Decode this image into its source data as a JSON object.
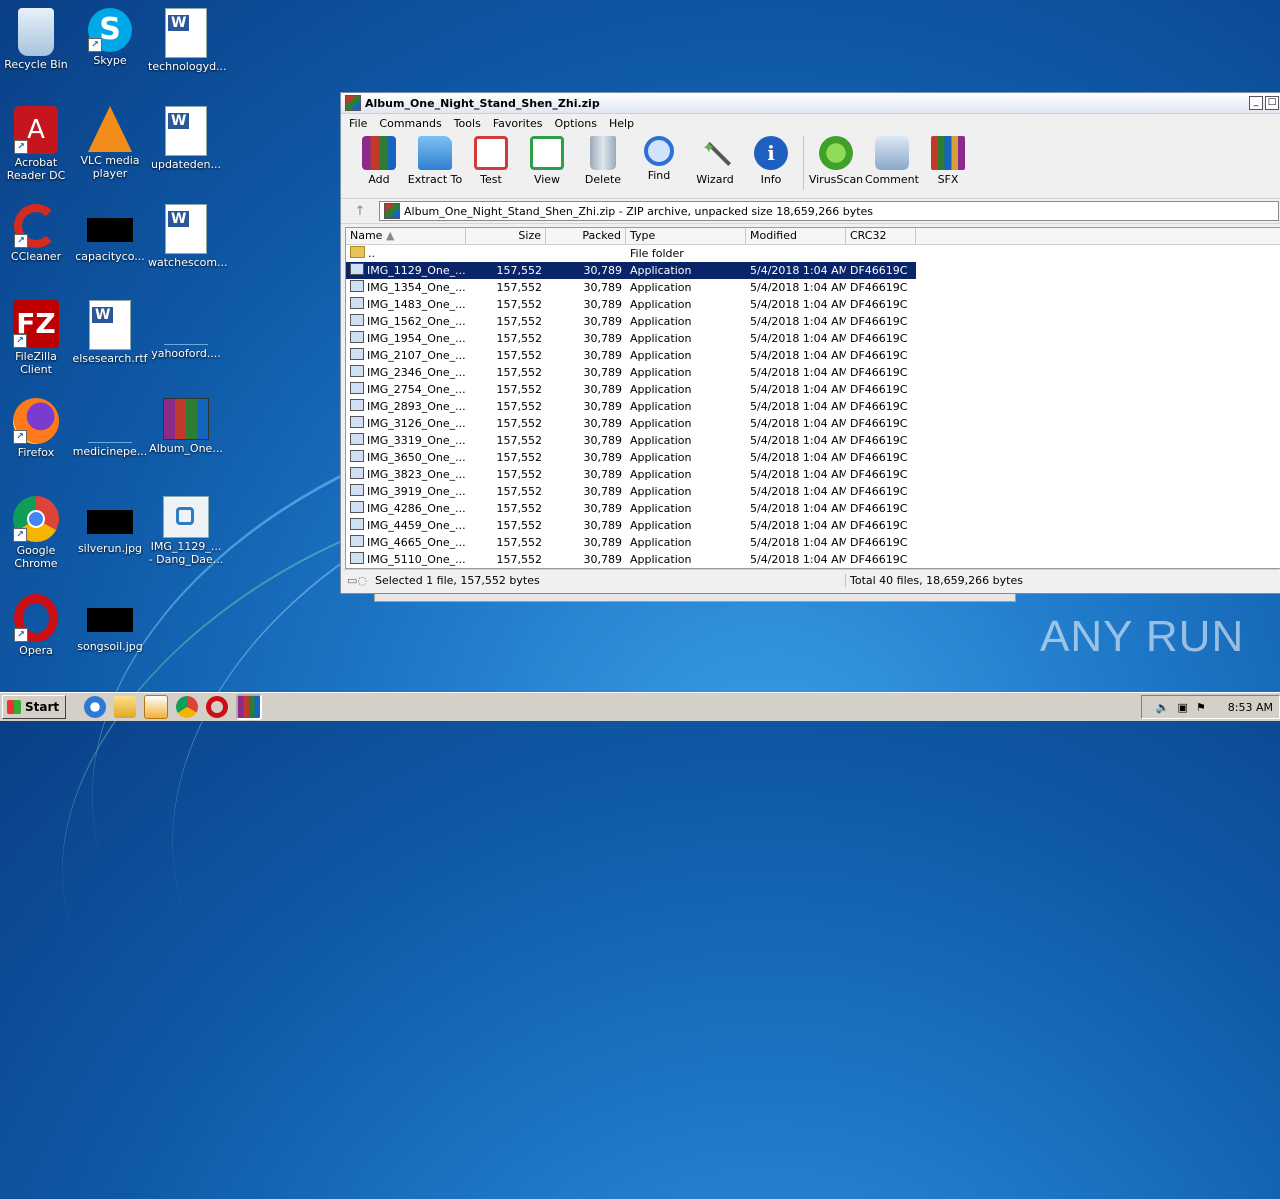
{
  "desktop": {
    "icons": [
      {
        "label": "Recycle Bin"
      },
      {
        "label": "Skype"
      },
      {
        "label": "technologyd..."
      },
      {
        "label": "Acrobat Reader DC"
      },
      {
        "label": "VLC media player"
      },
      {
        "label": "updateden..."
      },
      {
        "label": "CCleaner"
      },
      {
        "label": "capacityco..."
      },
      {
        "label": "watchescom..."
      },
      {
        "label": "FileZilla Client"
      },
      {
        "label": "elsesearch.rtf"
      },
      {
        "label": "yahooford...."
      },
      {
        "label": "Firefox"
      },
      {
        "label": "medicinepe..."
      },
      {
        "label": "Album_One..."
      },
      {
        "label": "Google Chrome"
      },
      {
        "label": "silverun.jpg"
      },
      {
        "label": "IMG_1129_... - Dang_Dae..."
      },
      {
        "label": "Opera"
      },
      {
        "label": "songsoil.jpg"
      }
    ]
  },
  "window": {
    "title": "Album_One_Night_Stand_Shen_Zhi.zip",
    "menu": [
      "File",
      "Commands",
      "Tools",
      "Favorites",
      "Options",
      "Help"
    ],
    "toolbar": [
      {
        "label": "Add",
        "color": "#c0392b"
      },
      {
        "label": "Extract To",
        "color": "#3b8fd8"
      },
      {
        "label": "Test",
        "color": "#d23b3b"
      },
      {
        "label": "View",
        "color": "#2e9e4a"
      },
      {
        "label": "Delete",
        "color": "#8a9bb0"
      },
      {
        "label": "Find",
        "color": "#2f6fd6"
      },
      {
        "label": "Wizard",
        "color": "#6aa9d8"
      },
      {
        "label": "Info",
        "color": "#1e5fc0"
      },
      {
        "label": "VirusScan",
        "color": "#3fa12a"
      },
      {
        "label": "Comment",
        "color": "#8aa8c8"
      },
      {
        "label": "SFX",
        "color": "#d9a03a"
      }
    ],
    "address": "Album_One_Night_Stand_Shen_Zhi.zip - ZIP archive, unpacked size 18,659,266 bytes",
    "columns": {
      "name": "Name",
      "size": "Size",
      "packed": "Packed",
      "type": "Type",
      "modified": "Modified",
      "crc": "CRC32"
    },
    "parent_row": {
      "name": "..",
      "type": "File folder"
    },
    "files": [
      {
        "name": "IMG_1129_One_...",
        "size": "157,552",
        "packed": "30,789",
        "type": "Application",
        "modified": "5/4/2018 1:04 AM",
        "crc": "DF46619C"
      },
      {
        "name": "IMG_1354_One_...",
        "size": "157,552",
        "packed": "30,789",
        "type": "Application",
        "modified": "5/4/2018 1:04 AM",
        "crc": "DF46619C"
      },
      {
        "name": "IMG_1483_One_...",
        "size": "157,552",
        "packed": "30,789",
        "type": "Application",
        "modified": "5/4/2018 1:04 AM",
        "crc": "DF46619C"
      },
      {
        "name": "IMG_1562_One_...",
        "size": "157,552",
        "packed": "30,789",
        "type": "Application",
        "modified": "5/4/2018 1:04 AM",
        "crc": "DF46619C"
      },
      {
        "name": "IMG_1954_One_...",
        "size": "157,552",
        "packed": "30,789",
        "type": "Application",
        "modified": "5/4/2018 1:04 AM",
        "crc": "DF46619C"
      },
      {
        "name": "IMG_2107_One_...",
        "size": "157,552",
        "packed": "30,789",
        "type": "Application",
        "modified": "5/4/2018 1:04 AM",
        "crc": "DF46619C"
      },
      {
        "name": "IMG_2346_One_...",
        "size": "157,552",
        "packed": "30,789",
        "type": "Application",
        "modified": "5/4/2018 1:04 AM",
        "crc": "DF46619C"
      },
      {
        "name": "IMG_2754_One_...",
        "size": "157,552",
        "packed": "30,789",
        "type": "Application",
        "modified": "5/4/2018 1:04 AM",
        "crc": "DF46619C"
      },
      {
        "name": "IMG_2893_One_...",
        "size": "157,552",
        "packed": "30,789",
        "type": "Application",
        "modified": "5/4/2018 1:04 AM",
        "crc": "DF46619C"
      },
      {
        "name": "IMG_3126_One_...",
        "size": "157,552",
        "packed": "30,789",
        "type": "Application",
        "modified": "5/4/2018 1:04 AM",
        "crc": "DF46619C"
      },
      {
        "name": "IMG_3319_One_...",
        "size": "157,552",
        "packed": "30,789",
        "type": "Application",
        "modified": "5/4/2018 1:04 AM",
        "crc": "DF46619C"
      },
      {
        "name": "IMG_3650_One_...",
        "size": "157,552",
        "packed": "30,789",
        "type": "Application",
        "modified": "5/4/2018 1:04 AM",
        "crc": "DF46619C"
      },
      {
        "name": "IMG_3823_One_...",
        "size": "157,552",
        "packed": "30,789",
        "type": "Application",
        "modified": "5/4/2018 1:04 AM",
        "crc": "DF46619C"
      },
      {
        "name": "IMG_3919_One_...",
        "size": "157,552",
        "packed": "30,789",
        "type": "Application",
        "modified": "5/4/2018 1:04 AM",
        "crc": "DF46619C"
      },
      {
        "name": "IMG_4286_One_...",
        "size": "157,552",
        "packed": "30,789",
        "type": "Application",
        "modified": "5/4/2018 1:04 AM",
        "crc": "DF46619C"
      },
      {
        "name": "IMG_4459_One_...",
        "size": "157,552",
        "packed": "30,789",
        "type": "Application",
        "modified": "5/4/2018 1:04 AM",
        "crc": "DF46619C"
      },
      {
        "name": "IMG_4665_One_...",
        "size": "157,552",
        "packed": "30,789",
        "type": "Application",
        "modified": "5/4/2018 1:04 AM",
        "crc": "DF46619C"
      },
      {
        "name": "IMG_5110_One_...",
        "size": "157,552",
        "packed": "30,789",
        "type": "Application",
        "modified": "5/4/2018 1:04 AM",
        "crc": "DF46619C"
      }
    ],
    "status_left": "Selected 1 file, 157,552 bytes",
    "status_right": "Total 40 files, 18,659,266 bytes"
  },
  "taskbar": {
    "start_label": "Start",
    "clock": "8:53 AM"
  },
  "watermark": "ANY RUN"
}
